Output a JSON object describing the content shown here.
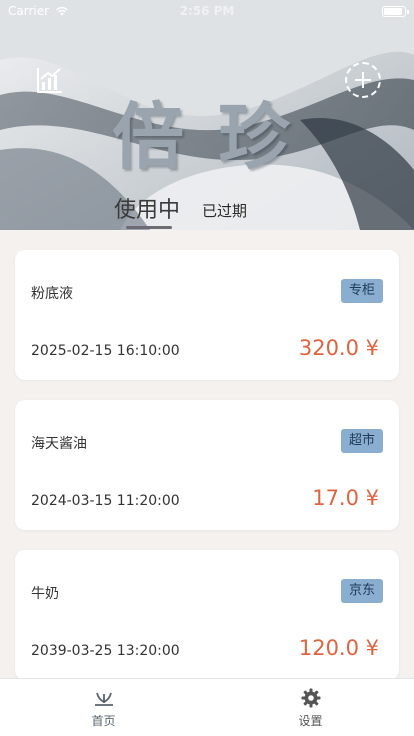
{
  "status_bar": {
    "carrier": "Carrier",
    "time": "2:56 PM"
  },
  "header": {
    "brand_title": "倍珍",
    "tabs": [
      {
        "label": "使用中",
        "active": true
      },
      {
        "label": "已过期",
        "active": false
      }
    ]
  },
  "items": [
    {
      "name": "粉底液",
      "tag": "专柜",
      "date": "2025-02-15 16:10:00",
      "price": "320.0 ¥"
    },
    {
      "name": "海天酱油",
      "tag": "超市",
      "date": "2024-03-15 11:20:00",
      "price": "17.0 ¥"
    },
    {
      "name": "牛奶",
      "tag": "京东",
      "date": "2039-03-25 13:20:00",
      "price": "120.0 ¥"
    }
  ],
  "tabbar": [
    {
      "label": "首页",
      "icon": "home-sprout-icon",
      "active": true
    },
    {
      "label": "设置",
      "icon": "gear-icon",
      "active": false
    }
  ],
  "colors": {
    "price": "#e0633f",
    "tag_bg": "#8aaed0",
    "tab_underline": "#6d6b73"
  }
}
